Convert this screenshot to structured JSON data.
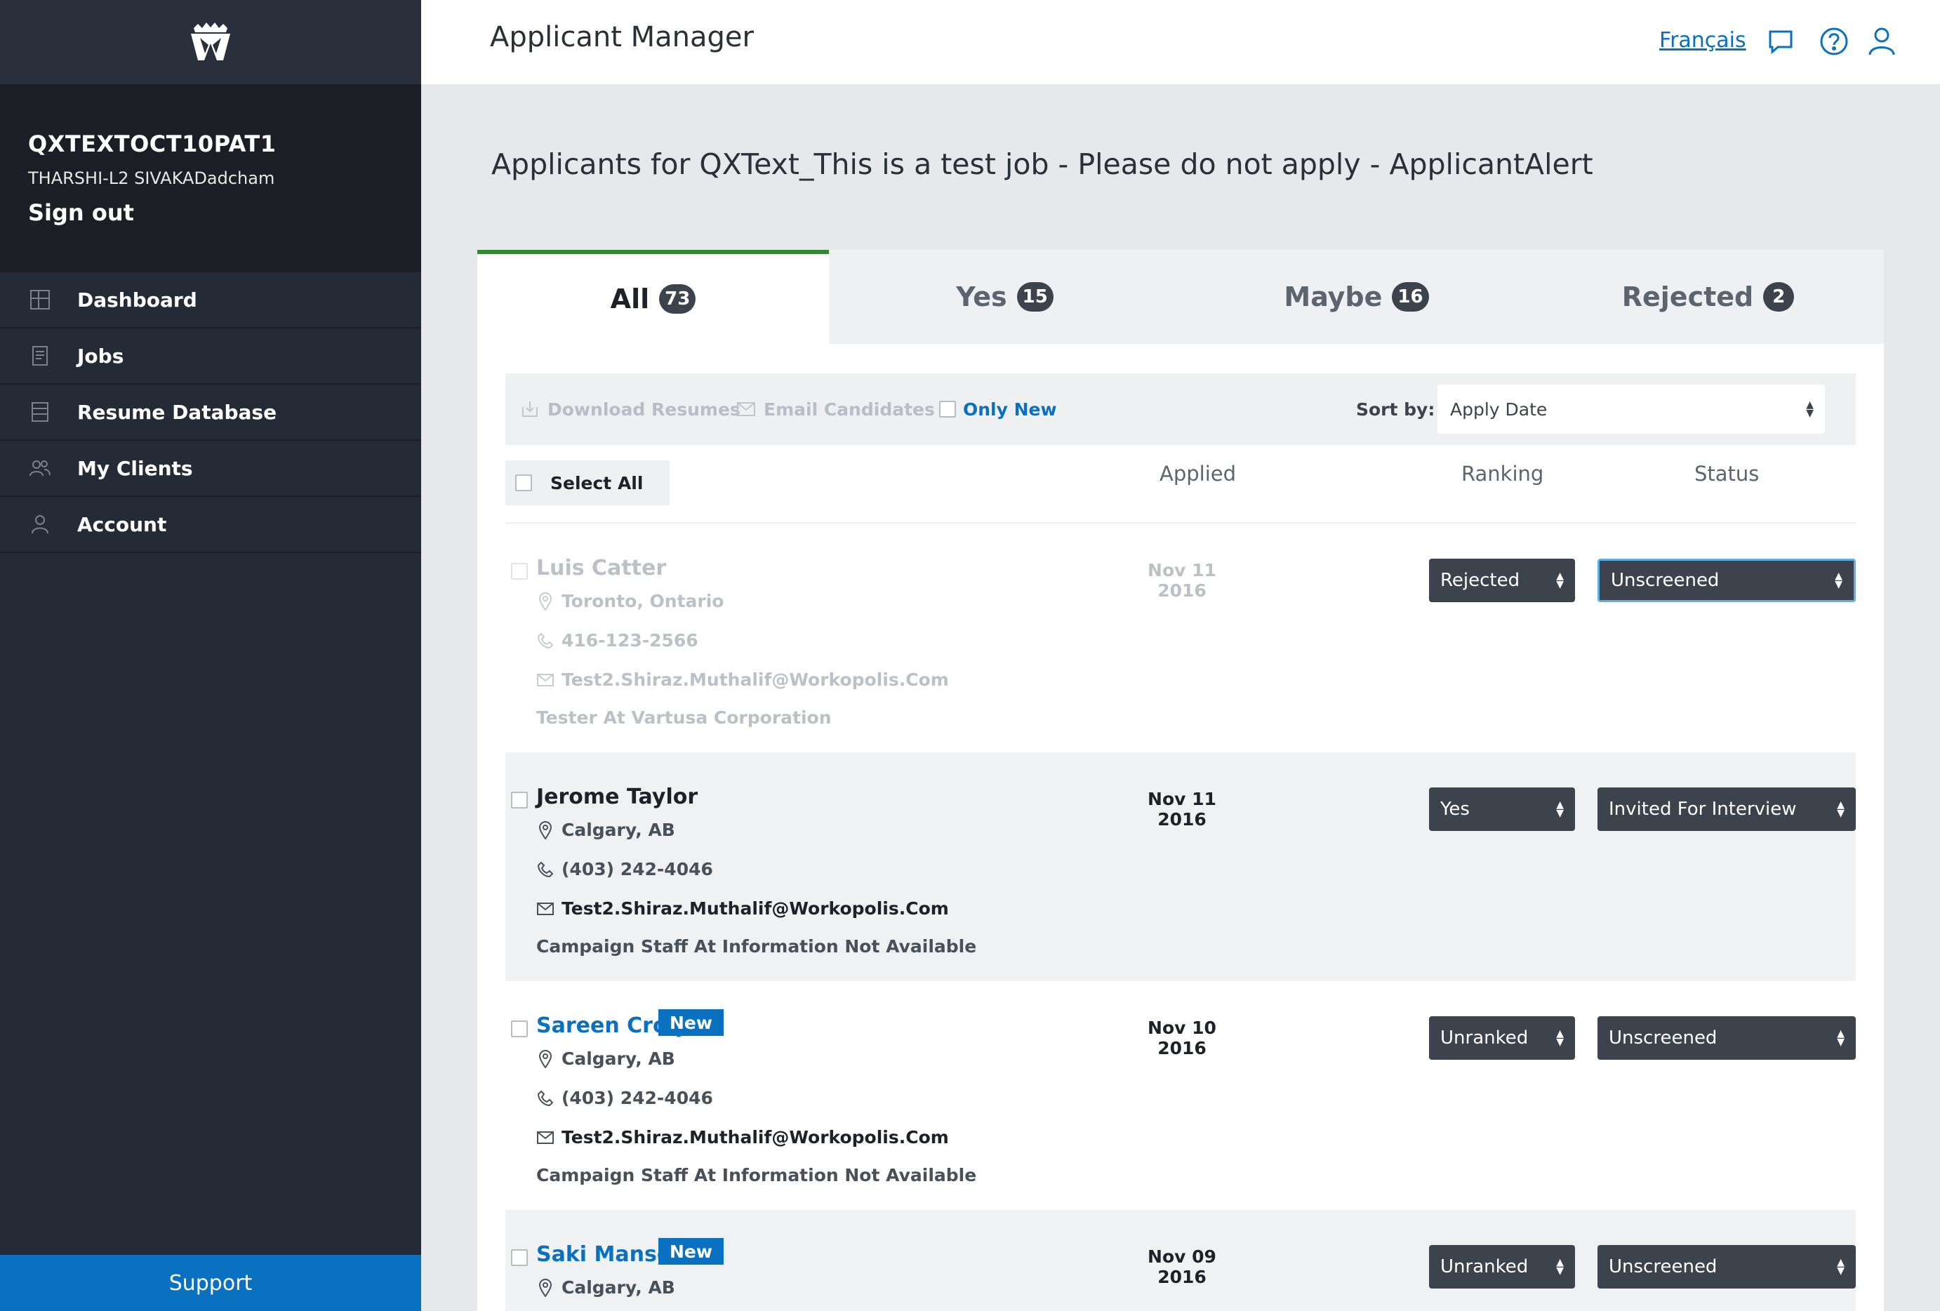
{
  "sidebar": {
    "account_name": "QXTEXTOCT10PAT1",
    "user_name": "THARSHI-L2 SIVAKADadcham",
    "sign_out": "Sign out",
    "items": [
      {
        "label": "Dashboard",
        "icon": "dashboard-icon"
      },
      {
        "label": "Jobs",
        "icon": "jobs-icon"
      },
      {
        "label": "Resume Database",
        "icon": "resume-database-icon"
      },
      {
        "label": "My Clients",
        "icon": "clients-icon"
      },
      {
        "label": "Account",
        "icon": "account-icon"
      }
    ],
    "support": "Support"
  },
  "header": {
    "title": "Applicant Manager",
    "language_link": "Français"
  },
  "page": {
    "heading": "Applicants for QXText_This is a test job - Please do not apply - ApplicantAlert"
  },
  "tabs": [
    {
      "label": "All",
      "count": "73"
    },
    {
      "label": "Yes",
      "count": "15"
    },
    {
      "label": "Maybe",
      "count": "16"
    },
    {
      "label": "Rejected",
      "count": "2"
    }
  ],
  "toolbar": {
    "download_resumes": "Download Resumes",
    "email_candidates": "Email Candidates",
    "only_new": "Only New",
    "sort_label": "Sort by:",
    "sort_value": "Apply Date"
  },
  "columns": {
    "select_all": "Select All",
    "applied": "Applied",
    "ranking": "Ranking",
    "status": "Status"
  },
  "applicants": [
    {
      "name": "Luis Catter",
      "location": "Toronto, Ontario",
      "phone": "416-123-2566",
      "email": "Test2.Shiraz.Muthalif@Workopolis.Com",
      "title": "Tester At Vartusa Corporation",
      "applied": "Nov 11 2016",
      "ranking": "Rejected",
      "status": "Unscreened",
      "badge": ""
    },
    {
      "name": "Jerome Taylor",
      "location": "Calgary, AB",
      "phone": "(403) 242-4046",
      "email": "Test2.Shiraz.Muthalif@Workopolis.Com",
      "title": "Campaign Staff At Information Not Available",
      "applied": "Nov 11 2016",
      "ranking": "Yes",
      "status": "Invited For Interview",
      "badge": ""
    },
    {
      "name": "Sareen Croq",
      "location": "Calgary, AB",
      "phone": "(403) 242-4046",
      "email": "Test2.Shiraz.Muthalif@Workopolis.Com",
      "title": "Campaign Staff At Information Not Available",
      "applied": "Nov 10 2016",
      "ranking": "Unranked",
      "status": "Unscreened",
      "badge": "New"
    },
    {
      "name": "Saki Manson",
      "location": "Calgary, AB",
      "applied": "Nov 09 2016",
      "ranking": "Unranked",
      "status": "Unscreened",
      "badge": "New"
    }
  ]
}
